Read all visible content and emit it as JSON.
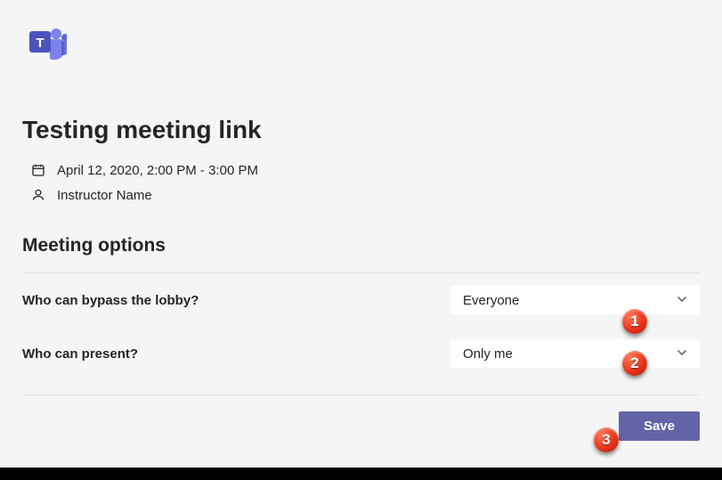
{
  "logo": {
    "letter": "T"
  },
  "meeting": {
    "title": "Testing meeting link",
    "datetime": "April 12, 2020, 2:00 PM - 3:00 PM",
    "organizer": "Instructor Name"
  },
  "options": {
    "heading": "Meeting options",
    "rows": [
      {
        "label": "Who can bypass the lobby?",
        "value": "Everyone"
      },
      {
        "label": "Who can present?",
        "value": "Only me"
      }
    ]
  },
  "actions": {
    "save": "Save"
  },
  "callouts": {
    "one": "1",
    "two": "2",
    "three": "3"
  },
  "colors": {
    "brand": "#6264a7",
    "calloutRed": "#e8321a"
  }
}
